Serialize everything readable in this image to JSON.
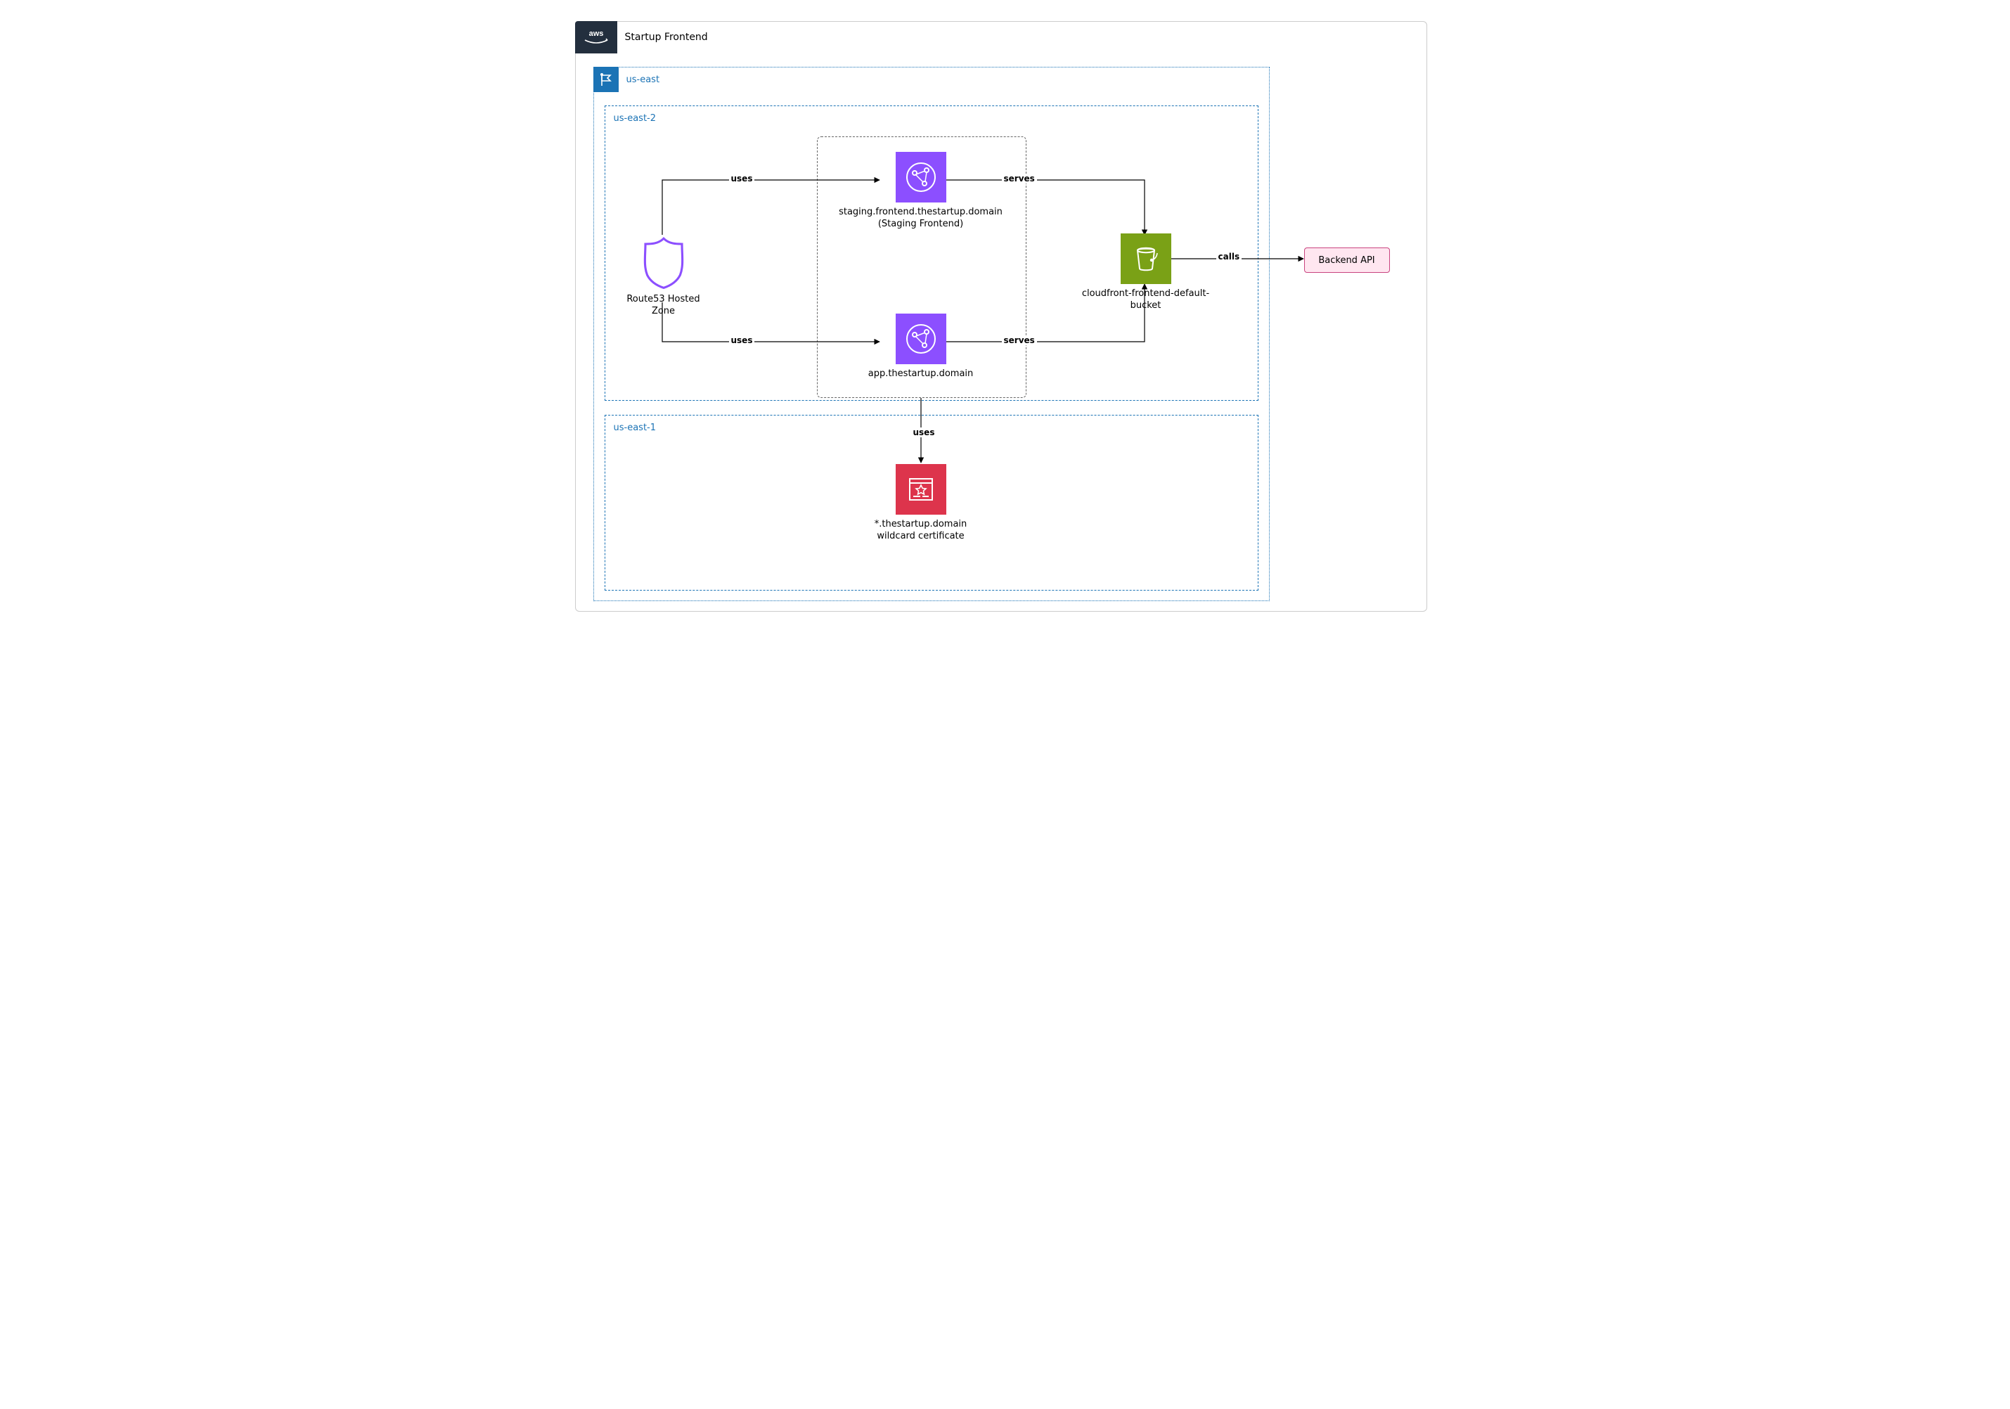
{
  "diagram": {
    "title": "Startup Frontend",
    "cloud_region_group": "us-east",
    "region2": "us-east-2",
    "region1": "us-east-1"
  },
  "nodes": {
    "route53": {
      "label": "Route53 Hosted\nZone"
    },
    "cf_staging": {
      "label": "staging.frontend.thestartup.domain\n(Staging Frontend)"
    },
    "cf_app": {
      "label": "app.thestartup.domain"
    },
    "s3": {
      "label": "cloudfront-frontend-default-bucket"
    },
    "cert": {
      "label": "*.thestartup.domain\nwildcard certificate"
    },
    "backend": {
      "label": "Backend API"
    }
  },
  "edges": {
    "uses1": "uses",
    "uses2": "uses",
    "serves1": "serves",
    "serves2": "serves",
    "calls": "calls",
    "uses_cert": "uses"
  },
  "colors": {
    "aws_dark": "#232f3e",
    "region_blue": "#1b73b5",
    "route53_purple": "#8c4fff",
    "cloudfront_purple": "#8c4fff",
    "s3_green": "#7aa116",
    "acm_red": "#dd344c",
    "backend_pink_bg": "#ffe6f0",
    "backend_pink_border": "#c9437f"
  }
}
